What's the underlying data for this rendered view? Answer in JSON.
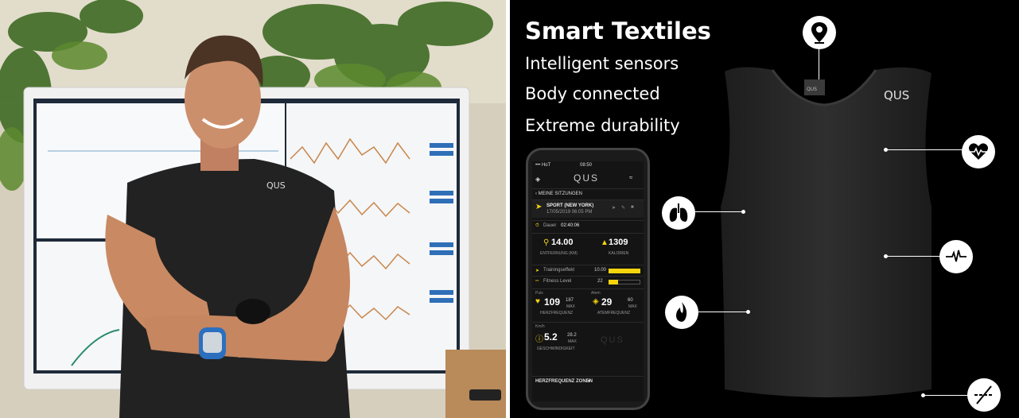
{
  "right": {
    "title": "Smart Textiles",
    "features": [
      "Intelligent sensors",
      "Body connected",
      "Extreme durability"
    ],
    "shirt_brand": "QUS",
    "tag_label": "QUS"
  },
  "phone": {
    "status_carrier": "••• HoT",
    "status_time": "08:50",
    "app_logo": "QUS",
    "back_label": "MEINE SITZUNGEN",
    "session_title": "SPORT (NEW YORK)",
    "session_date": "17/05/2019 06:05 PM",
    "duration_label": "Dauer",
    "duration_value": "02:40:06",
    "distance_value": "14.00",
    "distance_label": "ENTFERNUNG (KM)",
    "calories_value": "1309",
    "calories_label": "KALORIEN",
    "training_label": "Trainingseffekt",
    "training_value": "10.00",
    "training_fill": 1.0,
    "fitness_label": "Fitness Level",
    "fitness_value": "22",
    "fitness_fill": 0.3,
    "puls_label": "Puls",
    "hr_value": "109",
    "hr_max": "187",
    "hr_max_label": "MAX",
    "hr_label": "HERZFREQUENZ",
    "atem_label": "Atem",
    "resp_value": "29",
    "resp_max": "60",
    "resp_max_label": "MAX",
    "resp_label": "ATEMFREQUENZ",
    "km_label": "Km/h",
    "speed_value": "5.2",
    "speed_max": "28.2",
    "speed_max_label": "MAX",
    "speed_label": "GESCHWINDIGKEIT",
    "bottom_label": "HERZFREQUENZ ZONEN",
    "watermark": "QUS"
  },
  "colors": {
    "accent": "#f5d40e",
    "background": "#000000",
    "shirt": "#2b2b2b"
  },
  "icons": [
    "location-pin-icon",
    "heart-rate-icon",
    "lungs-icon",
    "pulse-icon",
    "flame-icon",
    "no-wash-icon"
  ]
}
